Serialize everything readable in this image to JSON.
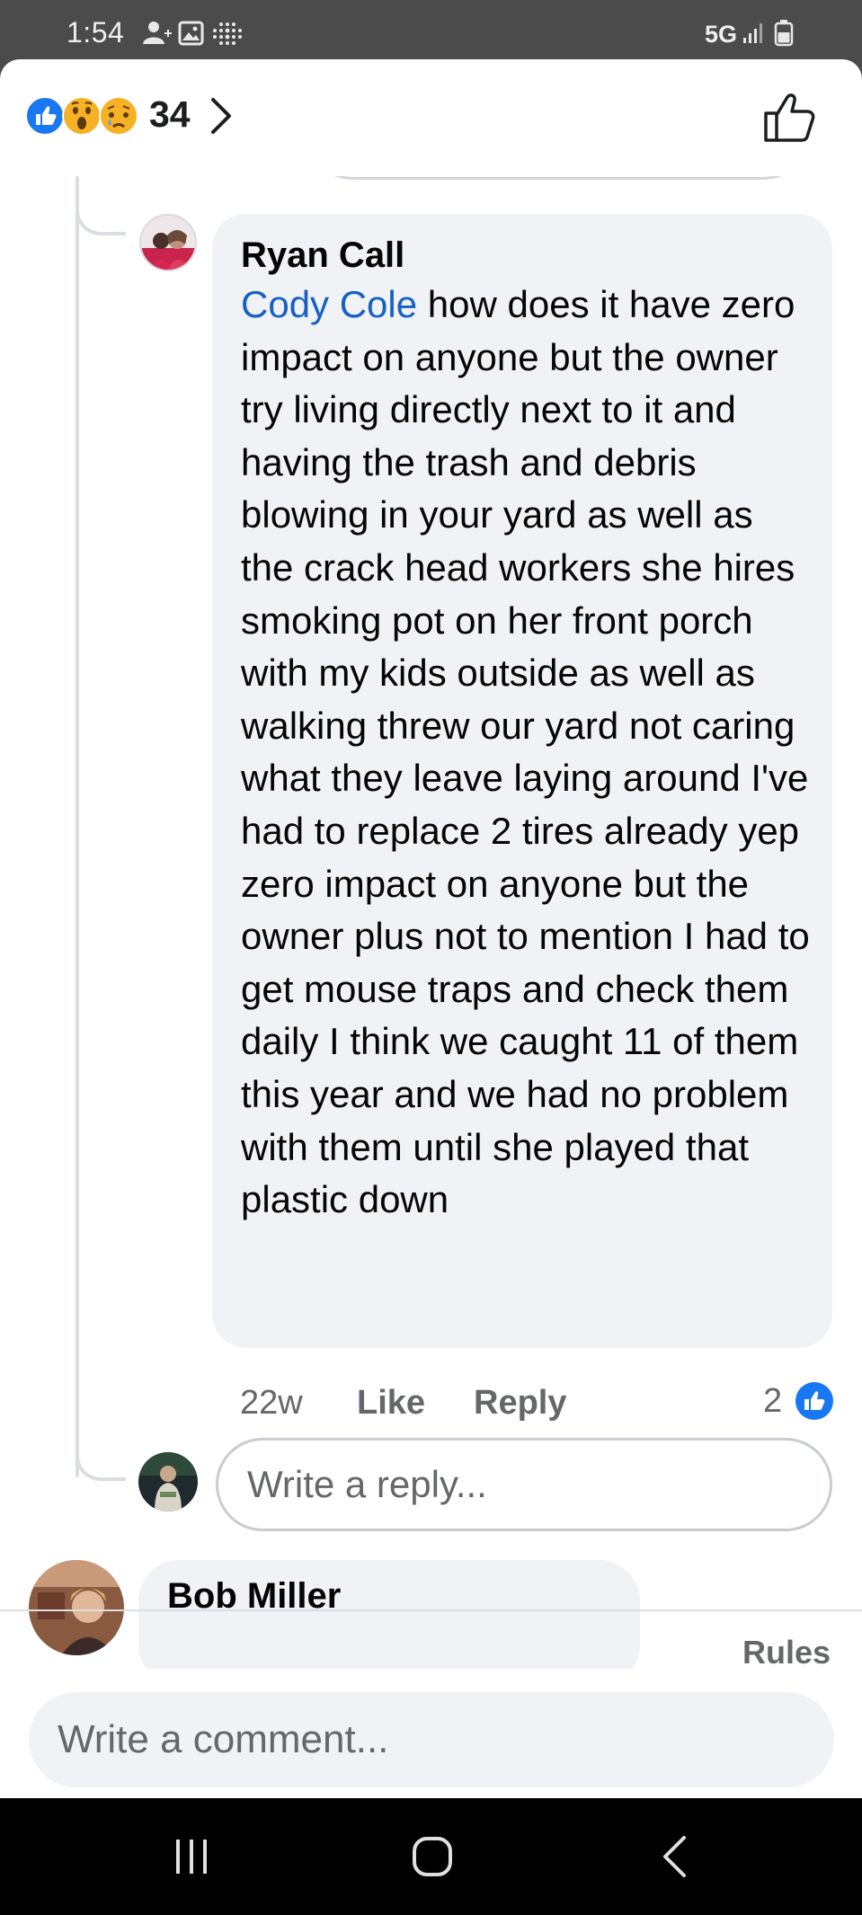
{
  "status_bar": {
    "time": "1:54",
    "network": "5G"
  },
  "header": {
    "reactions": [
      "like",
      "wow",
      "sad"
    ],
    "reaction_count": "34"
  },
  "comment": {
    "author": "Ryan Call",
    "mention": "Cody Cole",
    "text": " how does it have zero impact on anyone but the owner try living directly next to it and having the trash and debris blowing in your yard as well as the crack head workers she hires smoking pot on her front porch with my kids outside as well as walking threw our yard not caring what they leave laying around I've had to replace 2 tires already yep zero impact on anyone but the owner plus not to mention I had to get mouse traps and check them daily I think we caught 11 of them this year and we had no problem with them until she played that plastic down",
    "time": "22w",
    "like_label": "Like",
    "reply_label": "Reply",
    "like_count": "2"
  },
  "reply_box": {
    "placeholder": "Write a reply..."
  },
  "next_comment": {
    "author": "Bob Miller"
  },
  "footer": {
    "rules_label": "Rules",
    "comment_placeholder": "Write a comment..."
  },
  "colors": {
    "facebook_blue": "#1877f2",
    "mention_blue": "#1660c5",
    "bubble_gray": "#f0f2f5",
    "secondary_text": "#65676b"
  },
  "icons": [
    "contact-icon",
    "gallery-icon",
    "dots-grid-icon",
    "signal-icon",
    "battery-icon",
    "chevron-right-icon",
    "thumbs-up-icon",
    "recent-apps-icon",
    "home-icon",
    "back-icon"
  ]
}
